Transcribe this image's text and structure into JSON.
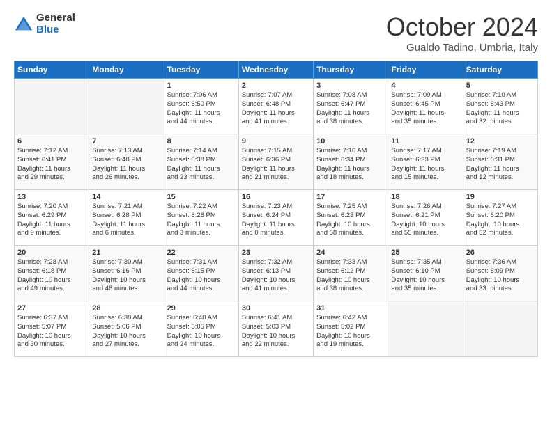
{
  "logo": {
    "general": "General",
    "blue": "Blue"
  },
  "title": "October 2024",
  "subtitle": "Gualdo Tadino, Umbria, Italy",
  "days_header": [
    "Sunday",
    "Monday",
    "Tuesday",
    "Wednesday",
    "Thursday",
    "Friday",
    "Saturday"
  ],
  "weeks": [
    [
      {
        "num": "",
        "lines": []
      },
      {
        "num": "",
        "lines": []
      },
      {
        "num": "1",
        "lines": [
          "Sunrise: 7:06 AM",
          "Sunset: 6:50 PM",
          "Daylight: 11 hours",
          "and 44 minutes."
        ]
      },
      {
        "num": "2",
        "lines": [
          "Sunrise: 7:07 AM",
          "Sunset: 6:48 PM",
          "Daylight: 11 hours",
          "and 41 minutes."
        ]
      },
      {
        "num": "3",
        "lines": [
          "Sunrise: 7:08 AM",
          "Sunset: 6:47 PM",
          "Daylight: 11 hours",
          "and 38 minutes."
        ]
      },
      {
        "num": "4",
        "lines": [
          "Sunrise: 7:09 AM",
          "Sunset: 6:45 PM",
          "Daylight: 11 hours",
          "and 35 minutes."
        ]
      },
      {
        "num": "5",
        "lines": [
          "Sunrise: 7:10 AM",
          "Sunset: 6:43 PM",
          "Daylight: 11 hours",
          "and 32 minutes."
        ]
      }
    ],
    [
      {
        "num": "6",
        "lines": [
          "Sunrise: 7:12 AM",
          "Sunset: 6:41 PM",
          "Daylight: 11 hours",
          "and 29 minutes."
        ]
      },
      {
        "num": "7",
        "lines": [
          "Sunrise: 7:13 AM",
          "Sunset: 6:40 PM",
          "Daylight: 11 hours",
          "and 26 minutes."
        ]
      },
      {
        "num": "8",
        "lines": [
          "Sunrise: 7:14 AM",
          "Sunset: 6:38 PM",
          "Daylight: 11 hours",
          "and 23 minutes."
        ]
      },
      {
        "num": "9",
        "lines": [
          "Sunrise: 7:15 AM",
          "Sunset: 6:36 PM",
          "Daylight: 11 hours",
          "and 21 minutes."
        ]
      },
      {
        "num": "10",
        "lines": [
          "Sunrise: 7:16 AM",
          "Sunset: 6:34 PM",
          "Daylight: 11 hours",
          "and 18 minutes."
        ]
      },
      {
        "num": "11",
        "lines": [
          "Sunrise: 7:17 AM",
          "Sunset: 6:33 PM",
          "Daylight: 11 hours",
          "and 15 minutes."
        ]
      },
      {
        "num": "12",
        "lines": [
          "Sunrise: 7:19 AM",
          "Sunset: 6:31 PM",
          "Daylight: 11 hours",
          "and 12 minutes."
        ]
      }
    ],
    [
      {
        "num": "13",
        "lines": [
          "Sunrise: 7:20 AM",
          "Sunset: 6:29 PM",
          "Daylight: 11 hours",
          "and 9 minutes."
        ]
      },
      {
        "num": "14",
        "lines": [
          "Sunrise: 7:21 AM",
          "Sunset: 6:28 PM",
          "Daylight: 11 hours",
          "and 6 minutes."
        ]
      },
      {
        "num": "15",
        "lines": [
          "Sunrise: 7:22 AM",
          "Sunset: 6:26 PM",
          "Daylight: 11 hours",
          "and 3 minutes."
        ]
      },
      {
        "num": "16",
        "lines": [
          "Sunrise: 7:23 AM",
          "Sunset: 6:24 PM",
          "Daylight: 11 hours",
          "and 0 minutes."
        ]
      },
      {
        "num": "17",
        "lines": [
          "Sunrise: 7:25 AM",
          "Sunset: 6:23 PM",
          "Daylight: 10 hours",
          "and 58 minutes."
        ]
      },
      {
        "num": "18",
        "lines": [
          "Sunrise: 7:26 AM",
          "Sunset: 6:21 PM",
          "Daylight: 10 hours",
          "and 55 minutes."
        ]
      },
      {
        "num": "19",
        "lines": [
          "Sunrise: 7:27 AM",
          "Sunset: 6:20 PM",
          "Daylight: 10 hours",
          "and 52 minutes."
        ]
      }
    ],
    [
      {
        "num": "20",
        "lines": [
          "Sunrise: 7:28 AM",
          "Sunset: 6:18 PM",
          "Daylight: 10 hours",
          "and 49 minutes."
        ]
      },
      {
        "num": "21",
        "lines": [
          "Sunrise: 7:30 AM",
          "Sunset: 6:16 PM",
          "Daylight: 10 hours",
          "and 46 minutes."
        ]
      },
      {
        "num": "22",
        "lines": [
          "Sunrise: 7:31 AM",
          "Sunset: 6:15 PM",
          "Daylight: 10 hours",
          "and 44 minutes."
        ]
      },
      {
        "num": "23",
        "lines": [
          "Sunrise: 7:32 AM",
          "Sunset: 6:13 PM",
          "Daylight: 10 hours",
          "and 41 minutes."
        ]
      },
      {
        "num": "24",
        "lines": [
          "Sunrise: 7:33 AM",
          "Sunset: 6:12 PM",
          "Daylight: 10 hours",
          "and 38 minutes."
        ]
      },
      {
        "num": "25",
        "lines": [
          "Sunrise: 7:35 AM",
          "Sunset: 6:10 PM",
          "Daylight: 10 hours",
          "and 35 minutes."
        ]
      },
      {
        "num": "26",
        "lines": [
          "Sunrise: 7:36 AM",
          "Sunset: 6:09 PM",
          "Daylight: 10 hours",
          "and 33 minutes."
        ]
      }
    ],
    [
      {
        "num": "27",
        "lines": [
          "Sunrise: 6:37 AM",
          "Sunset: 5:07 PM",
          "Daylight: 10 hours",
          "and 30 minutes."
        ]
      },
      {
        "num": "28",
        "lines": [
          "Sunrise: 6:38 AM",
          "Sunset: 5:06 PM",
          "Daylight: 10 hours",
          "and 27 minutes."
        ]
      },
      {
        "num": "29",
        "lines": [
          "Sunrise: 6:40 AM",
          "Sunset: 5:05 PM",
          "Daylight: 10 hours",
          "and 24 minutes."
        ]
      },
      {
        "num": "30",
        "lines": [
          "Sunrise: 6:41 AM",
          "Sunset: 5:03 PM",
          "Daylight: 10 hours",
          "and 22 minutes."
        ]
      },
      {
        "num": "31",
        "lines": [
          "Sunrise: 6:42 AM",
          "Sunset: 5:02 PM",
          "Daylight: 10 hours",
          "and 19 minutes."
        ]
      },
      {
        "num": "",
        "lines": []
      },
      {
        "num": "",
        "lines": []
      }
    ]
  ]
}
